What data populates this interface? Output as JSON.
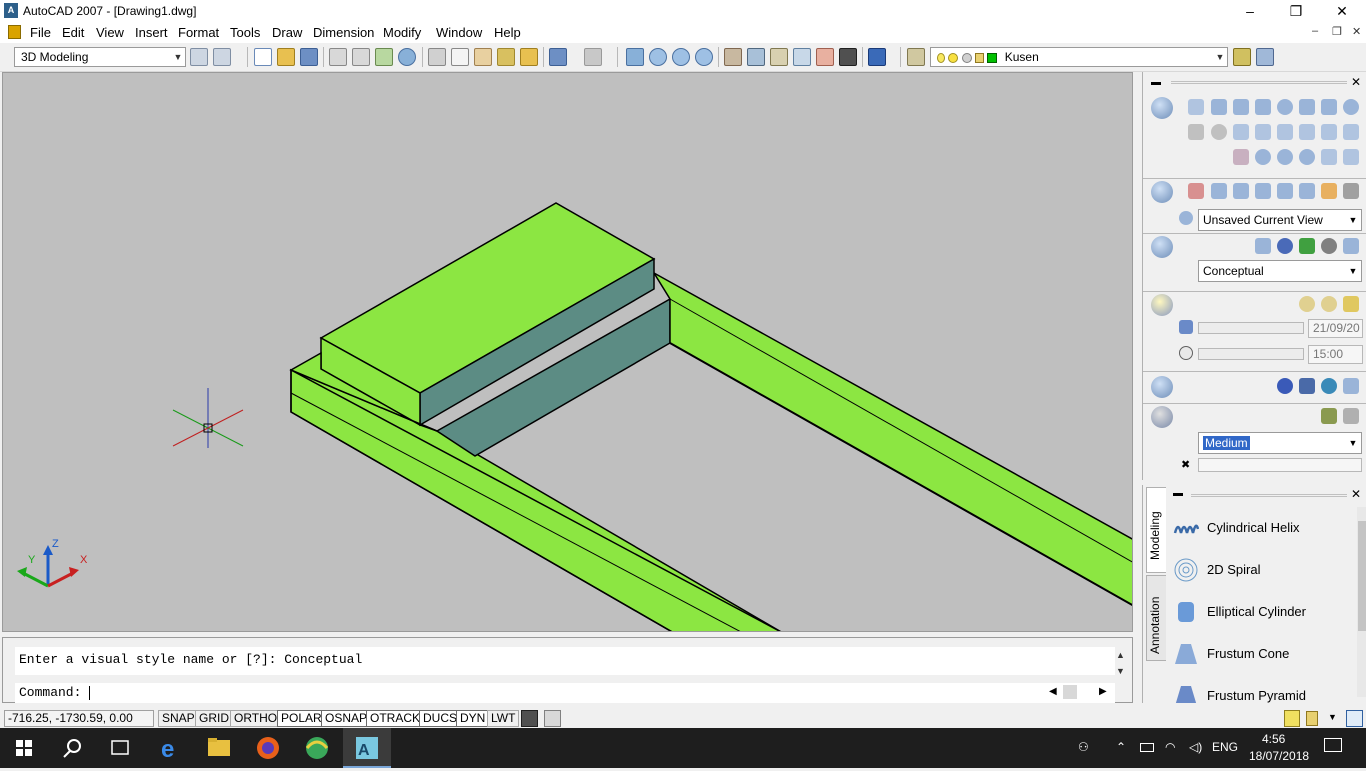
{
  "window": {
    "title": "AutoCAD 2007 - [Drawing1.dwg]",
    "app_icon_text": "A",
    "controls": [
      "–",
      "❐",
      "✕"
    ]
  },
  "menu": {
    "items": [
      "File",
      "Edit",
      "View",
      "Insert",
      "Format",
      "Tools",
      "Draw",
      "Dimension",
      "Modify",
      "Window",
      "Help"
    ],
    "doc_controls": [
      "–",
      "❐",
      "✕"
    ]
  },
  "toolbar": {
    "workspace": "3D Modeling",
    "layer": "Kusen",
    "layer_color": "#00c000"
  },
  "dashboard": {
    "view": "Unsaved Current View",
    "visual_style": "Conceptual",
    "date": "21/09/20",
    "time": "15:00",
    "material_quality": "Medium"
  },
  "command": {
    "history": "Enter a visual style name or [?]: Conceptual",
    "prompt": "Command:"
  },
  "status": {
    "coords": "-716.25, -1730.59, 0.00",
    "toggles": [
      {
        "label": "SNAP",
        "on": false
      },
      {
        "label": "GRID",
        "on": false
      },
      {
        "label": "ORTHO",
        "on": false
      },
      {
        "label": "POLAR",
        "on": true
      },
      {
        "label": "OSNAP",
        "on": true
      },
      {
        "label": "OTRACK",
        "on": true
      },
      {
        "label": "DUCS",
        "on": true
      },
      {
        "label": "DYN",
        "on": true
      },
      {
        "label": "LWT",
        "on": false
      }
    ]
  },
  "tool_palette": {
    "tabs": [
      "Modeling",
      "Annotation"
    ],
    "items": [
      "Cylindrical Helix",
      "2D Spiral",
      "Elliptical Cylinder",
      "Frustum Cone",
      "Frustum Pyramid"
    ]
  },
  "ucs": {
    "x": "X",
    "y": "Y",
    "z": "Z"
  },
  "taskbar": {
    "language": "ENG",
    "time": "4:56",
    "date": "18/07/2018"
  },
  "colors": {
    "model_top": "#8ce642",
    "model_side": "#5c8c84",
    "viewport_bg": "#bfbfbf"
  }
}
